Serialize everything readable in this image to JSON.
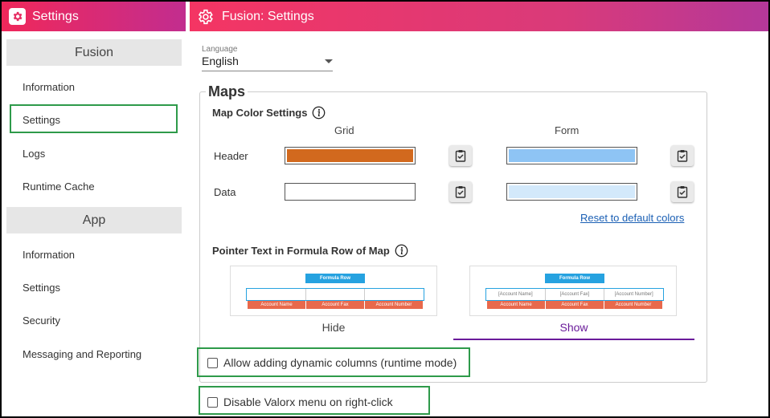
{
  "sidebar": {
    "title": "Settings",
    "sections": [
      {
        "label": "Fusion",
        "items": [
          "Information",
          "Settings",
          "Logs",
          "Runtime Cache"
        ]
      },
      {
        "label": "App",
        "items": [
          "Information",
          "Settings",
          "Security",
          "Messaging and Reporting"
        ]
      }
    ],
    "selected": "Fusion / Settings"
  },
  "header": {
    "title": "Fusion: Settings"
  },
  "language": {
    "label": "Language",
    "value": "English"
  },
  "maps": {
    "legend": "Maps",
    "color_settings": {
      "title": "Map Color Settings",
      "columns": [
        "Grid",
        "Form"
      ],
      "rows": [
        {
          "label": "Header",
          "grid_color": "#d2691e",
          "form_color": "#8ec4f4"
        },
        {
          "label": "Data",
          "grid_color": "#ffffff",
          "form_color": "#d3e9fb"
        }
      ],
      "reset_link": "Reset to default colors"
    },
    "pointer_text": {
      "title": "Pointer Text in Formula Row of Map",
      "preview": {
        "formula_label": "Formula Row",
        "headers": [
          "Account Name",
          "Account Fax",
          "Account Number"
        ],
        "pointer_cells": [
          "[Account Name]",
          "[Account Fax]",
          "[Account Number]"
        ]
      },
      "options": [
        "Hide",
        "Show"
      ],
      "selected": "Show"
    },
    "dynamic_columns": {
      "label": "Allow adding dynamic columns (runtime mode)",
      "checked": false
    }
  },
  "disable_menu": {
    "label": "Disable Valorx menu on right-click",
    "checked": false
  },
  "colors": {
    "accent_purple": "#6a1b9a",
    "highlight_green": "#2e9a4a",
    "link_blue": "#1a5fb4"
  }
}
